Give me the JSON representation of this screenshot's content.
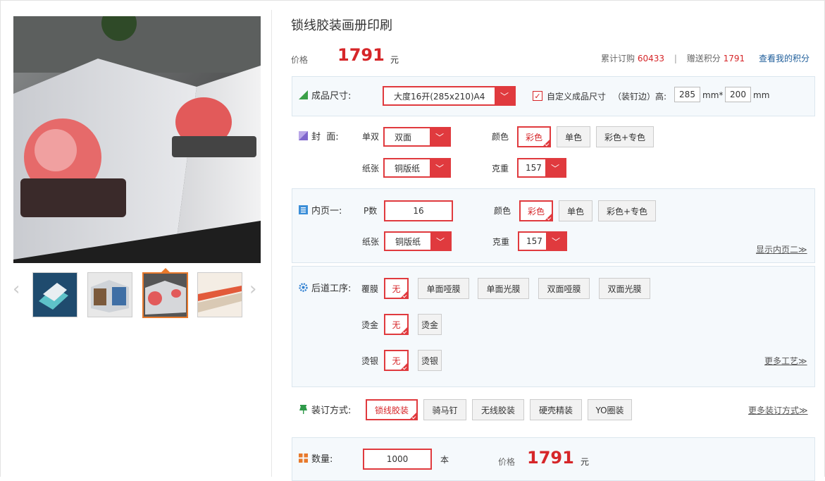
{
  "product": {
    "title": "锁线胶装画册印刷",
    "price_label": "价格",
    "price": "1791",
    "price_unit": "元"
  },
  "stats": {
    "orders_label": "累计订购",
    "orders": "60433",
    "sep": "|",
    "points_label": "赠送积分",
    "points": "1791",
    "my_points_link": "查看我的积分"
  },
  "size": {
    "label": "成品尺寸:",
    "selected": "大度16开(285x210)A4",
    "custom_label": "自定义成品尺寸",
    "binding_edge_label": "（装钉边）高:",
    "height": "285",
    "unit1": "mm*",
    "width": "200",
    "unit2": "mm"
  },
  "cover": {
    "label": "封  面:",
    "sides_label": "单双",
    "sides": "双面",
    "color_label": "颜色",
    "color_options": [
      "彩色",
      "单色",
      "彩色+专色"
    ],
    "paper_label": "纸张",
    "paper": "铜版纸",
    "weight_label": "克重",
    "weight": "157"
  },
  "inner": {
    "label": "内页一:",
    "pages_label": "P数",
    "pages": "16",
    "color_label": "颜色",
    "color_options": [
      "彩色",
      "单色",
      "彩色+专色"
    ],
    "paper_label": "纸张",
    "paper": "铜版纸",
    "weight_label": "克重",
    "weight": "157",
    "show_more": "显示内页二≫"
  },
  "finishing": {
    "label": "后道工序:",
    "film_label": "覆膜",
    "film_options": [
      "无",
      "单面哑膜",
      "单面光膜",
      "双面哑膜",
      "双面光膜"
    ],
    "gold_label": "烫金",
    "gold_options": [
      "无",
      "烫金"
    ],
    "silver_label": "烫银",
    "silver_options": [
      "无",
      "烫银"
    ],
    "more": "更多工艺≫"
  },
  "binding": {
    "label": "装订方式:",
    "options": [
      "锁线胶装",
      "骑马钉",
      "无线胶装",
      "硬壳精装",
      "YO圈装"
    ],
    "more": "更多装订方式≫"
  },
  "quantity": {
    "label": "数量:",
    "value": "1000",
    "unit": "本",
    "price_label": "价格",
    "price": "1791",
    "price_unit": "元"
  },
  "icons": {
    "size": "triangle-ruler-icon",
    "cover": "cover-square-icon",
    "inner": "list-page-icon",
    "finishing": "gear-icon",
    "binding": "pin-icon",
    "quantity": "grid-icon"
  },
  "colors": {
    "accent": "#e03a3e",
    "price": "#d62629",
    "panel_bg": "#f5f9fc",
    "link": "#1e5d9a"
  }
}
